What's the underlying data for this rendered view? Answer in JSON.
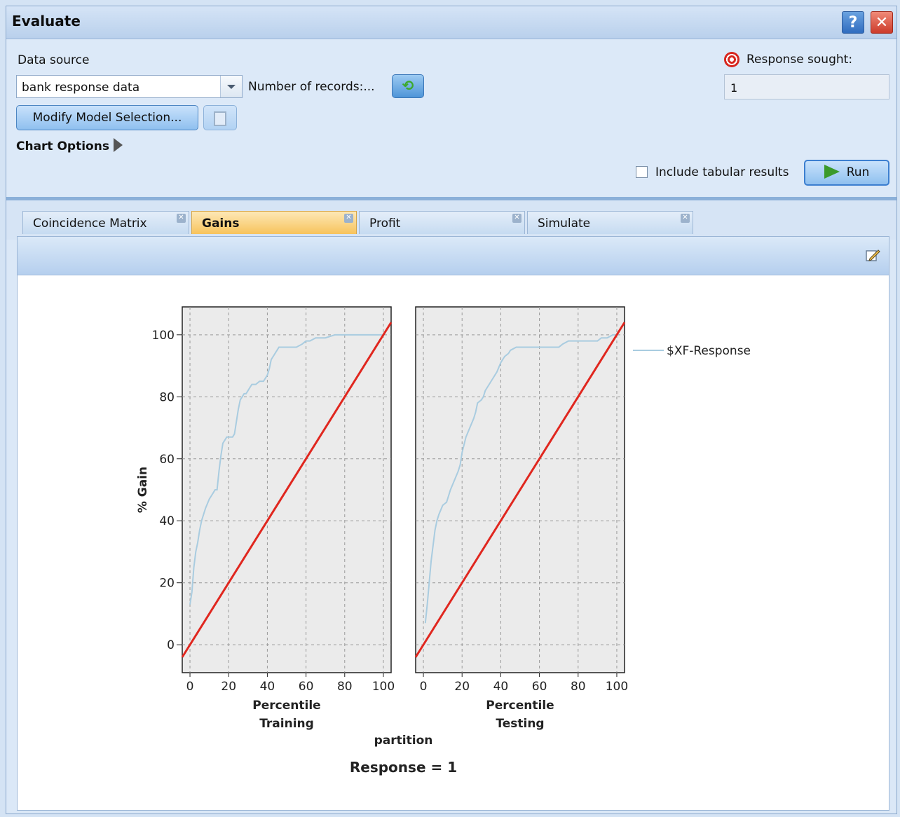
{
  "window": {
    "title": "Evaluate",
    "help_label": "?",
    "close_label": "✕"
  },
  "data_source": {
    "label": "Data source",
    "value": "bank response data",
    "records_label": "Number of records:...",
    "modify_label": "Modify Model Selection..."
  },
  "chart_options_label": "Chart Options",
  "response": {
    "label": "Response sought:",
    "value": "1"
  },
  "include_tabular": {
    "label": "Include tabular results",
    "checked": false
  },
  "run_label": "Run",
  "tabs": [
    {
      "label": "Coincidence Matrix",
      "active": false
    },
    {
      "label": "Gains",
      "active": true
    },
    {
      "label": "Profit",
      "active": false
    },
    {
      "label": "Simulate",
      "active": false
    }
  ],
  "colors": {
    "model_line": "#a9cce0",
    "baseline": "#e0271f",
    "plot_bg": "#ebebeb"
  },
  "icons": [
    "help-icon",
    "close-icon",
    "dropdown-arrow-icon",
    "refresh-icon",
    "copy-icon",
    "target-icon",
    "play-icon",
    "edit-icon"
  ],
  "chart_data": {
    "type": "line",
    "title": "Response = 1",
    "ylabel": "% Gain",
    "group_label": "partition",
    "xlim": [
      -4,
      104
    ],
    "ylim": [
      -9,
      109
    ],
    "xticks": [
      0,
      20,
      40,
      60,
      80,
      100
    ],
    "yticks": [
      0,
      20,
      40,
      60,
      80,
      100
    ],
    "grid": true,
    "legend_position": "right",
    "panels": [
      {
        "xlabel": "Percentile",
        "panel_label": "Training",
        "series": [
          {
            "name": "$XF-Response",
            "x": [
              0,
              1,
              2,
              3,
              4,
              5,
              6,
              8,
              10,
              11,
              12,
              13,
              14,
              15,
              16,
              17,
              18,
              19,
              20,
              22,
              23,
              24,
              25,
              26,
              27,
              28,
              29,
              30,
              31,
              32,
              34,
              36,
              38,
              39,
              40,
              41,
              42,
              43,
              44,
              45,
              46,
              48,
              50,
              52,
              55,
              58,
              60,
              62,
              65,
              70,
              75,
              80,
              90,
              100
            ],
            "y": [
              13,
              17,
              25,
              30,
              33,
              37,
              40,
              44,
              47,
              48,
              49,
              50,
              50,
              56,
              61,
              65,
              66,
              67,
              67,
              67,
              68,
              72,
              76,
              79,
              80,
              81,
              81,
              82,
              83,
              84,
              84,
              85,
              85,
              86,
              87,
              89,
              92,
              93,
              94,
              95,
              96,
              96,
              96,
              96,
              96,
              97,
              98,
              98,
              99,
              99,
              100,
              100,
              100,
              100
            ]
          },
          {
            "name": "",
            "x": [
              -4,
              104
            ],
            "y": [
              -4,
              104
            ]
          }
        ]
      },
      {
        "xlabel": "Percentile",
        "panel_label": "Testing",
        "series": [
          {
            "name": "$XF-Response",
            "x": [
              1,
              2,
              3,
              4,
              5,
              6,
              7,
              8,
              10,
              12,
              14,
              16,
              18,
              19,
              20,
              22,
              24,
              26,
              27,
              28,
              30,
              31,
              32,
              34,
              36,
              37,
              38,
              40,
              42,
              44,
              45,
              48,
              50,
              55,
              60,
              65,
              70,
              72,
              75,
              80,
              85,
              90,
              92,
              95,
              98,
              100
            ],
            "y": [
              7,
              13,
              20,
              27,
              32,
              37,
              40,
              42,
              45,
              46,
              50,
              53,
              56,
              58,
              62,
              67,
              70,
              73,
              75,
              78,
              79,
              80,
              82,
              84,
              86,
              87,
              88,
              91,
              93,
              94,
              95,
              96,
              96,
              96,
              96,
              96,
              96,
              97,
              98,
              98,
              98,
              98,
              99,
              99,
              100,
              100
            ]
          },
          {
            "name": "",
            "x": [
              -4,
              104
            ],
            "y": [
              -4,
              104
            ]
          }
        ]
      }
    ]
  }
}
